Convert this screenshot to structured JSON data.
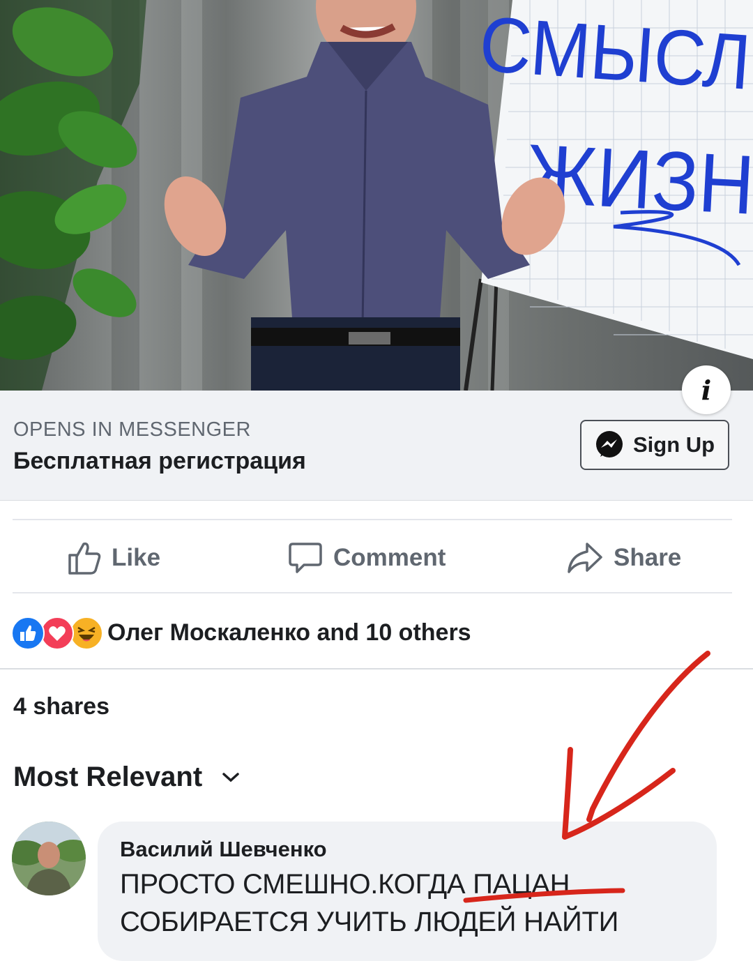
{
  "video": {
    "flipchart_line1": "СМЫСЛ",
    "flipchart_line2": "ЖИЗНИ",
    "info_glyph": "i"
  },
  "cta": {
    "kicker": "OPENS IN MESSENGER",
    "title": "Бесплатная регистрация",
    "button_label": "Sign Up",
    "button_icon": "messenger-icon"
  },
  "actions": {
    "like": "Like",
    "comment": "Comment",
    "share": "Share"
  },
  "reactions": {
    "icons": [
      "like-reaction-icon",
      "love-reaction-icon",
      "haha-reaction-icon"
    ],
    "summary": "Олег Москаленко and 10 others",
    "colors": {
      "like": "#1877f2",
      "love": "#f33e58",
      "haha": "#f7b125"
    }
  },
  "shares": "4 shares",
  "sort": {
    "label": "Most Relevant",
    "icon": "chevron-down-icon"
  },
  "comment": {
    "author": "Василий Шевченко",
    "line1": "ПРОСТО СМЕШНО.КОГДА ПАЦАН",
    "line2": "СОБИРАЕТСЯ УЧИТЬ ЛЮДЕЙ НАЙТИ"
  },
  "annotation_color": "#d7261b"
}
